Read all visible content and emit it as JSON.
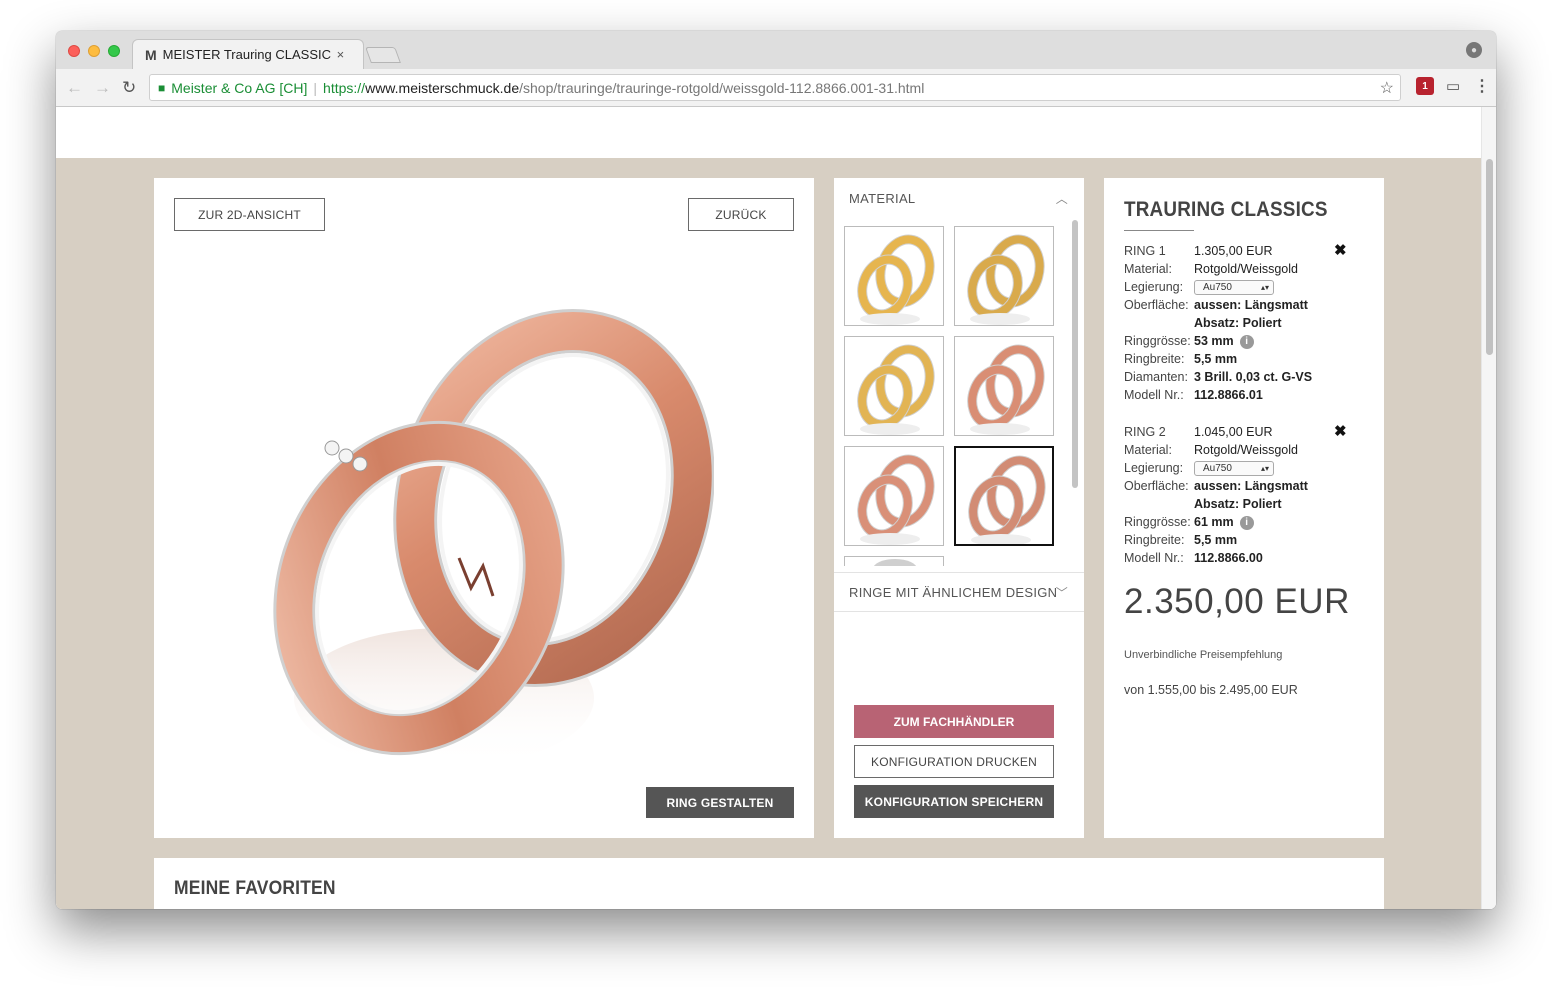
{
  "browser": {
    "tab_title": "MEISTER Trauring CLASSICS T",
    "tab_close": "×",
    "cert_name": "Meister & Co AG [CH]",
    "url_scheme": "https://",
    "url_host": "www.meisterschmuck.de",
    "url_path": "/shop/trauringe/trauringe-rotgold/weissgold-112.8866.001-31.html",
    "extension_badge": "1"
  },
  "viewer": {
    "btn_2d": "ZUR 2D-ANSICHT",
    "btn_back": "ZURÜCK",
    "btn_design": "RING GESTALTEN"
  },
  "options": {
    "material_header": "MATERIAL",
    "similar_header": "RINGE MIT ÄHNLICHEM DESIGN",
    "thumbnails": [
      {
        "metal": "yellow-gold",
        "color": "#e6b54f"
      },
      {
        "metal": "yellow-white-gold",
        "color": "#d9aa4c"
      },
      {
        "metal": "yellow-gold",
        "color": "#e2b454"
      },
      {
        "metal": "rose-gold",
        "color": "#d98e74"
      },
      {
        "metal": "rose-white-gold",
        "color": "#d99078"
      },
      {
        "metal": "rose-white-gold",
        "color": "#d28c74",
        "selected": true
      }
    ],
    "btn_dealer": "ZUM FACHHÄNDLER",
    "btn_print": "KONFIGURATION DRUCKEN",
    "btn_save": "KONFIGURATION SPEICHERN"
  },
  "summary": {
    "title": "TRAURING CLASSICS",
    "ring1": {
      "label": "RING 1",
      "price": "1.305,00 EUR",
      "material_label": "Material:",
      "material": "Rotgold/Weissgold",
      "alloy_label": "Legierung:",
      "alloy": "Au750",
      "surface_label": "Oberfläche:",
      "surface_outer": "aussen: Längsmatt",
      "surface_step": "Absatz: Poliert",
      "size_label": "Ringgrösse:",
      "size": "53 mm",
      "width_label": "Ringbreite:",
      "width": "5,5 mm",
      "diamonds_label": "Diamanten:",
      "diamonds": "3 Brill. 0,03 ct. G-VS",
      "model_label": "Modell Nr.:",
      "model": "112.8866.01"
    },
    "ring2": {
      "label": "RING 2",
      "price": "1.045,00 EUR",
      "material_label": "Material:",
      "material": "Rotgold/Weissgold",
      "alloy_label": "Legierung:",
      "alloy": "Au750",
      "surface_label": "Oberfläche:",
      "surface_outer": "aussen: Längsmatt",
      "surface_step": "Absatz: Poliert",
      "size_label": "Ringgrösse:",
      "size": "61 mm",
      "width_label": "Ringbreite:",
      "width": "5,5 mm",
      "model_label": "Modell Nr.:",
      "model": "112.8866.00"
    },
    "total": "2.350,00 EUR",
    "hint": "Unverbindliche Preisempfehlung",
    "range": "von 1.555,00 bis 2.495,00 EUR"
  },
  "favorites": {
    "title": "MEINE FAVORITEN"
  },
  "colors": {
    "page_bg": "#d7cfc3",
    "accent_rose": "#b86374",
    "dark_button": "#555555"
  }
}
